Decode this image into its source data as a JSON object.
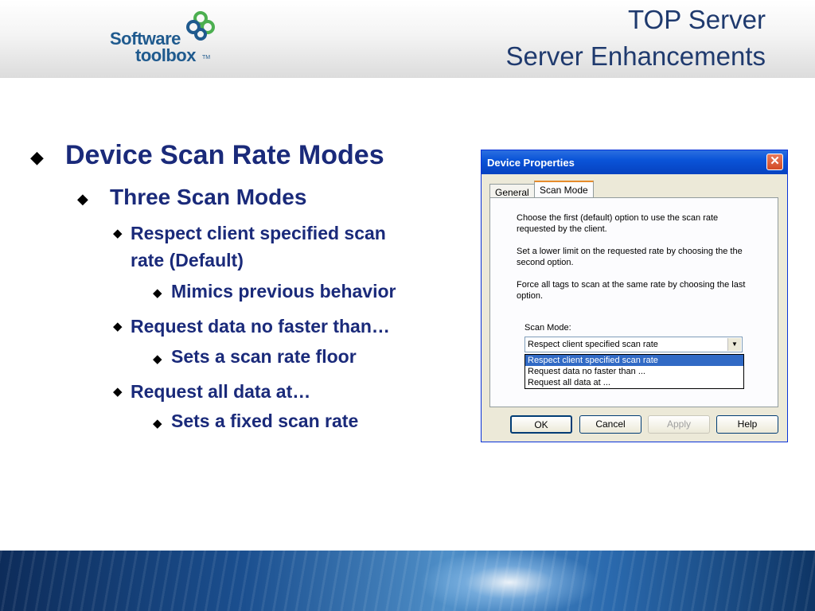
{
  "header": {
    "title_line1": "TOP Server",
    "title_line2": "Server Enhancements",
    "logo_word1": "Software",
    "logo_word2": "toolbox",
    "logo_tm": "TM"
  },
  "bullets": [
    {
      "level": 1,
      "text": "Device Scan Rate Modes"
    },
    {
      "level": 2,
      "text": "Three Scan Modes"
    },
    {
      "level": 3,
      "text": "Respect client specified scan"
    },
    {
      "level": 3,
      "text": "rate (Default)"
    },
    {
      "level": 4,
      "text": "Mimics previous behavior"
    },
    {
      "level": 3,
      "text": "Request data no faster than…"
    },
    {
      "level": 4,
      "text": "Sets a scan rate floor"
    },
    {
      "level": 3,
      "text": "Request all data at…"
    },
    {
      "level": 4,
      "text": "Sets a fixed scan rate"
    }
  ],
  "dialog": {
    "title": "Device Properties",
    "close_glyph": "✕",
    "tabs": [
      "General",
      "Scan Mode"
    ],
    "paragraphs": [
      "Choose the first (default) option to use the scan rate requested by the client.",
      "Set a lower limit on the requested rate by choosing the the second option.",
      "Force all tags to scan at the same rate by choosing the last option."
    ],
    "scan_mode_label": "Scan Mode:",
    "selected_value": "Respect client specified scan rate",
    "options": [
      "Respect client specified scan rate",
      "Request data no faster than ...",
      "Request all data at ..."
    ],
    "buttons": {
      "ok": "OK",
      "cancel": "Cancel",
      "apply": "Apply",
      "help": "Help"
    }
  },
  "colors": {
    "bullet_text": "#1a2a7a",
    "title_text": "#1f3a6e",
    "logo": "#1f5a8e",
    "titlebar": "#0a54d8"
  }
}
